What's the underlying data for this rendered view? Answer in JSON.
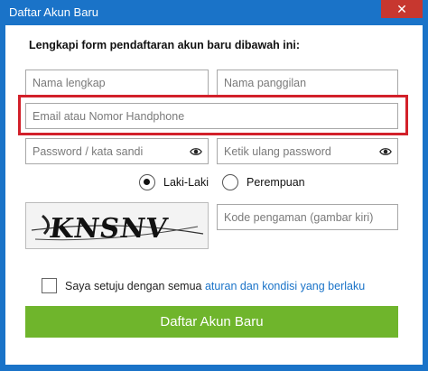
{
  "window": {
    "title": "Daftar Akun Baru",
    "close_label": "✕",
    "accent_color": "#1a73c8"
  },
  "form": {
    "heading": "Lengkapi form pendaftaran akun baru dibawah ini:",
    "full_name_placeholder": "Nama lengkap",
    "nickname_placeholder": "Nama panggilan",
    "email_phone_placeholder": "Email atau Nomor Handphone",
    "password_placeholder": "Password / kata sandi",
    "password_repeat_placeholder": "Ketik ulang password",
    "gender_male": "Laki-Laki",
    "gender_female": "Perempuan",
    "gender_selected": "Laki-Laki",
    "captcha_text": "KNSNV",
    "captcha_placeholder": "Kode pengaman (gambar kiri)",
    "agree_prefix": "Saya setuju dengan semua ",
    "agree_link": "aturan dan kondisi yang berlaku",
    "submit_label": "Daftar Akun Baru",
    "submit_color": "#6fb52c",
    "highlight_color": "#d2202a"
  }
}
